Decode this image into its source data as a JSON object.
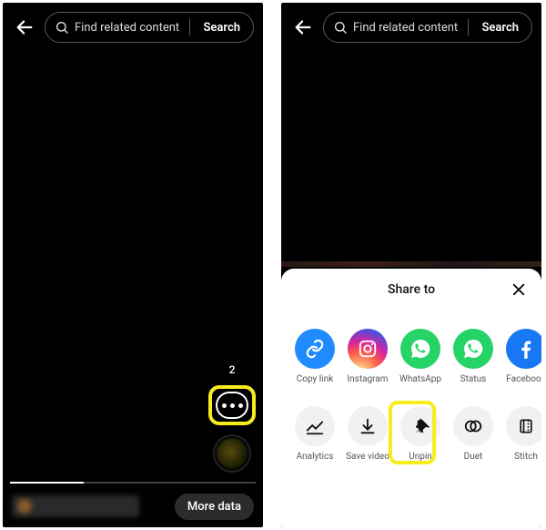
{
  "search": {
    "placeholder": "Find related content",
    "action": "Search"
  },
  "left": {
    "save_count": "2",
    "more_data_label": "More data"
  },
  "sheet": {
    "title": "Share to",
    "share_items": [
      {
        "label": "Copy link"
      },
      {
        "label": "Instagram"
      },
      {
        "label": "WhatsApp"
      },
      {
        "label": "Status"
      },
      {
        "label": "Facebook"
      }
    ],
    "action_items": [
      {
        "label": "Analytics"
      },
      {
        "label": "Save video"
      },
      {
        "label": "Unpin"
      },
      {
        "label": "Duet"
      },
      {
        "label": "Stitch"
      }
    ]
  }
}
